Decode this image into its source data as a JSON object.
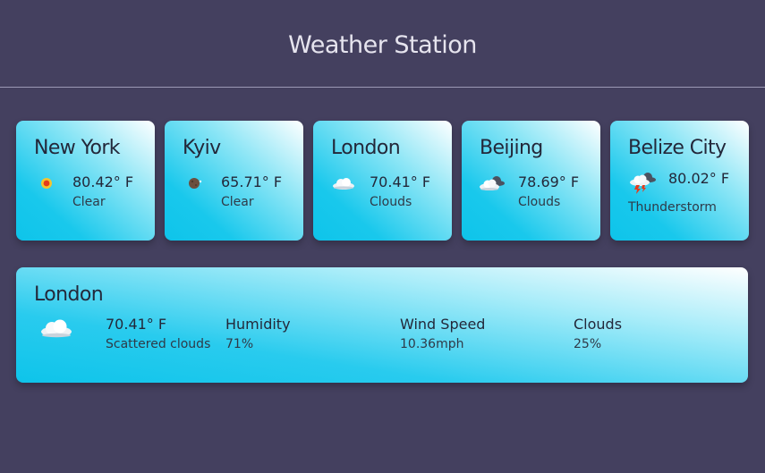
{
  "header": {
    "title": "Weather Station"
  },
  "cards": [
    {
      "city": "New York",
      "temp": "80.42° F",
      "desc": "Clear",
      "icon": "sun-icon"
    },
    {
      "city": "Kyiv",
      "temp": "65.71° F",
      "desc": "Clear",
      "icon": "moon-icon"
    },
    {
      "city": "London",
      "temp": "70.41° F",
      "desc": "Clouds",
      "icon": "cloud-icon"
    },
    {
      "city": "Beijing",
      "temp": "78.69° F",
      "desc": "Clouds",
      "icon": "dark-cloud-icon"
    },
    {
      "city": "Belize City",
      "temp": "80.02° F",
      "desc": "Thunderstorm",
      "icon": "thunderstorm-icon"
    }
  ],
  "detail": {
    "city": "London",
    "temp": "70.41° F",
    "desc": "Scattered clouds",
    "icon": "cloud-icon",
    "humidity_label": "Humidity",
    "humidity_value": "71%",
    "wind_label": "Wind Speed",
    "wind_value": "10.36mph",
    "clouds_label": "Clouds",
    "clouds_value": "25%"
  },
  "colors": {
    "background": "#44405f",
    "card_accent": "#19c8ec"
  }
}
